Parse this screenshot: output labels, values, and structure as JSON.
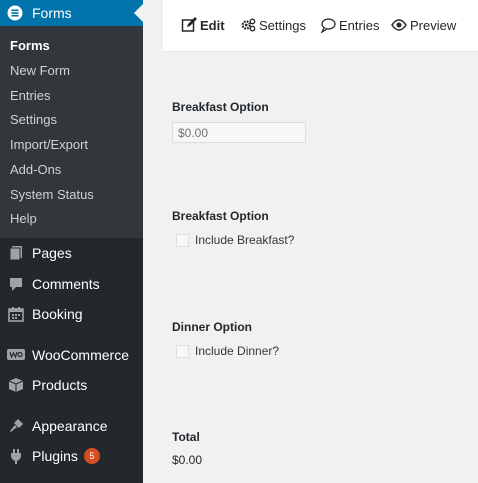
{
  "sidebar": {
    "active_menu": {
      "label": "Forms",
      "icon": "forms-icon"
    },
    "submenu": [
      {
        "label": "Forms",
        "current": true
      },
      {
        "label": "New Form"
      },
      {
        "label": "Entries"
      },
      {
        "label": "Settings"
      },
      {
        "label": "Import/Export"
      },
      {
        "label": "Add-Ons"
      },
      {
        "label": "System Status"
      },
      {
        "label": "Help"
      }
    ],
    "items": [
      {
        "label": "Pages",
        "icon": "pages-icon"
      },
      {
        "label": "Comments",
        "icon": "comments-icon"
      },
      {
        "label": "Booking",
        "icon": "calendar-icon"
      },
      {
        "label": "WooCommerce",
        "icon": "woocommerce-icon"
      },
      {
        "label": "Products",
        "icon": "products-icon"
      },
      {
        "label": "Appearance",
        "icon": "appearance-icon"
      },
      {
        "label": "Plugins",
        "icon": "plugins-icon",
        "badge": "5"
      }
    ]
  },
  "tabs": [
    {
      "label": "Edit",
      "icon": "edit-icon",
      "active": true
    },
    {
      "label": "Settings",
      "icon": "settings-gear-icon"
    },
    {
      "label": "Entries",
      "icon": "entries-bubble-icon"
    },
    {
      "label": "Preview",
      "icon": "preview-eye-icon"
    }
  ],
  "form": {
    "field1": {
      "label": "Breakfast Option",
      "placeholder": "$0.00"
    },
    "field2": {
      "label": "Breakfast Option",
      "checkbox_label": "Include Breakfast?"
    },
    "field3": {
      "label": "Dinner Option",
      "checkbox_label": "Include Dinner?"
    },
    "total": {
      "label": "Total",
      "value": "$0.00"
    }
  },
  "colors": {
    "sidebar_bg": "#23282d",
    "submenu_bg": "#32373c",
    "active_bg": "#0073aa",
    "badge_bg": "#d54e21"
  }
}
